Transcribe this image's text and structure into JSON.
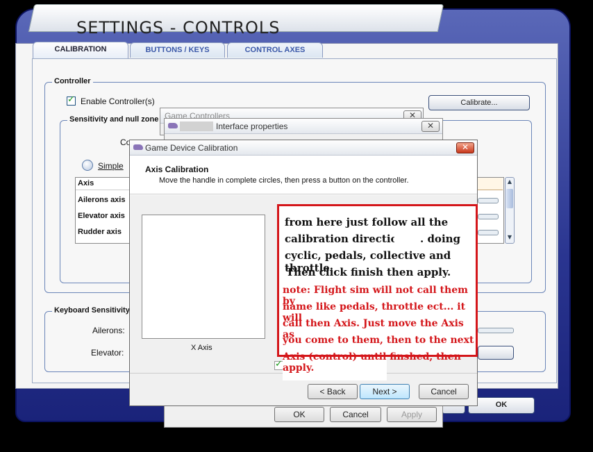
{
  "settings": {
    "title": "SETTINGS - CONTROLS",
    "tabs": [
      "CALIBRATION",
      "BUTTONS / KEYS",
      "CONTROL AXES"
    ],
    "controller_group": "Controller",
    "enable_controller": "Enable Controller(s)",
    "enable_checked": true,
    "calibrate_button": "Calibrate...",
    "sensitivity_group": "Sensitivity and null zone",
    "controller_label_partial": "Co",
    "simple_label_partial": "Simple",
    "axis_list": {
      "header": "Axis",
      "rows": [
        "Ailerons axis",
        "Elevator axis",
        "Rudder axis"
      ]
    },
    "keyboard_group": "Keyboard Sensitivity",
    "ailerons_label": "Ailerons:",
    "elevator_label": "Elevator:",
    "ok_button": "OK"
  },
  "game_controllers": {
    "title_partial": "Game Controllers"
  },
  "interface_properties": {
    "title": "Interface properties",
    "ok": "OK",
    "cancel": "Cancel",
    "apply": "Apply"
  },
  "calibration": {
    "title": "Game Device Calibration",
    "heading": "Axis Calibration",
    "subheading": "Move the handle in complete circles, then press a button on the controller.",
    "axis_box_label": "X Axis",
    "back": "< Back",
    "next": "Next >",
    "cancel": "Cancel"
  },
  "annotation": {
    "line1": "from here just follow all the",
    "line2a": "calibration directions",
    "line2b": ". doing",
    "line3": "cyclic, pedals, collective and throttle.",
    "line4": "Then click finish then apply.",
    "note1": "note: Flight sim will not call them by",
    "note2": "name like pedals, throttle ect... it will",
    "note3": "call then Axis. Just move the Axis as",
    "note4": "you come to them, then to the next",
    "note5": "Axis (control) until finshed, then apply.",
    "note_color": "#d4161a"
  },
  "colors": {
    "fs_frame": "#2a3590",
    "accent_blue": "#3a58a8",
    "annotation_red": "#d4161a"
  }
}
